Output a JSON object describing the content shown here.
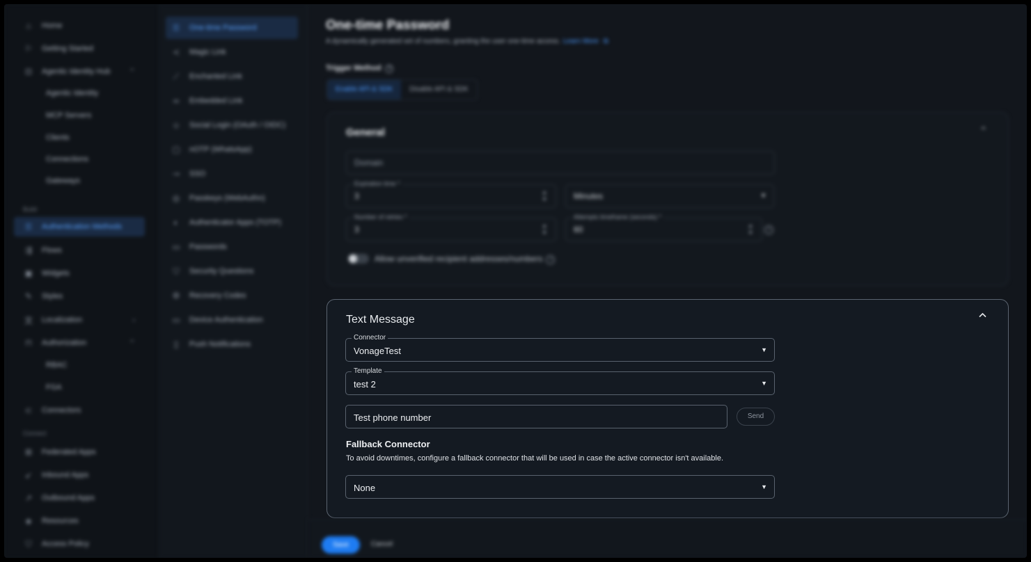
{
  "nav": {
    "items": [
      {
        "label": "Home",
        "icon": "home-icon"
      },
      {
        "label": "Getting Started",
        "icon": "flag-icon"
      },
      {
        "label": "Agentic Identity Hub",
        "icon": "hub-icon"
      },
      {
        "label": "Agentic Identity",
        "icon": ""
      },
      {
        "label": "MCP Servers",
        "icon": ""
      },
      {
        "label": "Clients",
        "icon": ""
      },
      {
        "label": "Connections",
        "icon": ""
      },
      {
        "label": "Gateways",
        "icon": ""
      },
      {
        "label": "Authentication Methods",
        "icon": "key-icon"
      },
      {
        "label": "Flows",
        "icon": "flow-icon"
      },
      {
        "label": "Widgets",
        "icon": "widget-icon"
      },
      {
        "label": "Styles",
        "icon": "brush-icon"
      },
      {
        "label": "Localization",
        "icon": "translate-icon"
      },
      {
        "label": "Authorization",
        "icon": "lock-icon"
      },
      {
        "label": "RBAC",
        "icon": ""
      },
      {
        "label": "FGA",
        "icon": ""
      },
      {
        "label": "Connectors",
        "icon": "plug-icon"
      },
      {
        "label": "Federated Apps",
        "icon": "apps-icon"
      },
      {
        "label": "Inbound Apps",
        "icon": "inbound-icon"
      },
      {
        "label": "Outbound Apps",
        "icon": "outbound-icon"
      },
      {
        "label": "Resources",
        "icon": "resource-icon"
      },
      {
        "label": "Access Policy",
        "icon": "policy-icon"
      }
    ],
    "sections": [
      "Build",
      "Connect"
    ]
  },
  "methods": [
    "One-time Password",
    "Magic Link",
    "Enchanted Link",
    "Embedded Link",
    "Social Login (OAuth / OIDC)",
    "nOTP (WhatsApp)",
    "SSO",
    "Passkeys (WebAuthn)",
    "Authenticator Apps (TOTP)",
    "Passwords",
    "Security Questions",
    "Recovery Codes",
    "Device Authentication",
    "Push Notifications"
  ],
  "page": {
    "title": "One-time Password",
    "subtitle": "A dynamically generated set of numbers, granting the user one-time access.",
    "learn_more": "Learn More",
    "trigger_label": "Trigger Method",
    "trigger_options": [
      "Enable API & SDK",
      "Disable API & SDK"
    ]
  },
  "general": {
    "title": "General",
    "domain_placeholder": "Domain",
    "expiration_label": "Expiration time *",
    "expiration_value": "3",
    "unit_value": "Minutes",
    "retries_label": "Number of retries *",
    "retries_value": "3",
    "timeframe_label": "Attempts timeframe (seconds) *",
    "timeframe_value": "60",
    "allow_unverified": "Allow unverified recipient addresses/numbers"
  },
  "text_message": {
    "title": "Text Message",
    "connector_label": "Connector",
    "connector_value": "VonageTest",
    "template_label": "Template",
    "template_value": "test 2",
    "phone_placeholder": "Test phone number",
    "send_label": "Send",
    "fallback_title": "Fallback Connector",
    "fallback_desc": "To avoid downtimes, configure a fallback connector that will be used in case the active connector isn't available.",
    "fallback_value": "None"
  },
  "footer": {
    "save_label": "Save",
    "cancel_label": "Cancel"
  }
}
